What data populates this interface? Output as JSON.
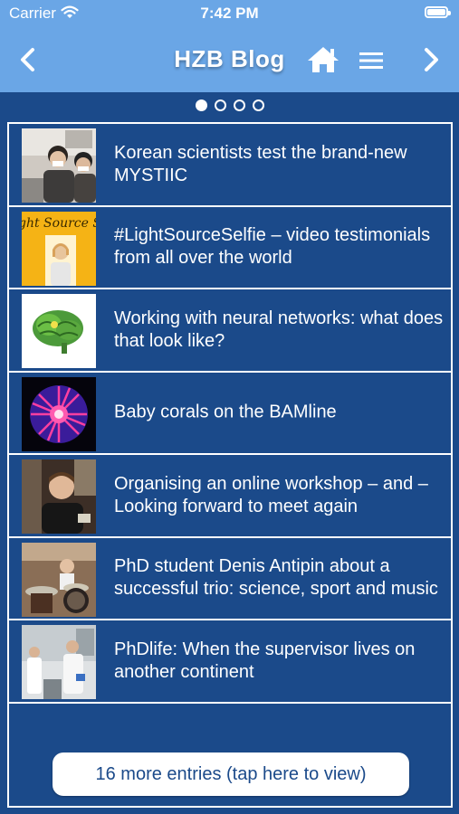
{
  "status_bar": {
    "carrier": "Carrier",
    "time": "7:42 PM"
  },
  "nav": {
    "title": "HZB Blog",
    "back_icon": "chevron-left-icon",
    "forward_icon": "chevron-right-icon",
    "home_icon": "home-icon",
    "menu_icon": "menu-icon"
  },
  "pager": {
    "total": 4,
    "active": 1
  },
  "entries": [
    {
      "title": "Korean scientists test the brand-new MYSTIIC"
    },
    {
      "title": "#LightSourceSelfie – video testimonials from all over the world",
      "thumb_text": "ght Source Se"
    },
    {
      "title": "Working with neural networks: what does that look like?"
    },
    {
      "title": "Baby corals on the BAMline"
    },
    {
      "title": "Organising an online workshop – and – Looking forward to meet again"
    },
    {
      "title": "PhD student Denis Antipin about a successful trio: science, sport and music"
    },
    {
      "title": "PhDlife: When the supervisor lives on another continent"
    }
  ],
  "more_button": {
    "label": "16 more entries (tap here to view)"
  },
  "colors": {
    "nav_bg": "#6aa6e6",
    "list_bg": "#1b4a8a",
    "text": "#ffffff"
  }
}
